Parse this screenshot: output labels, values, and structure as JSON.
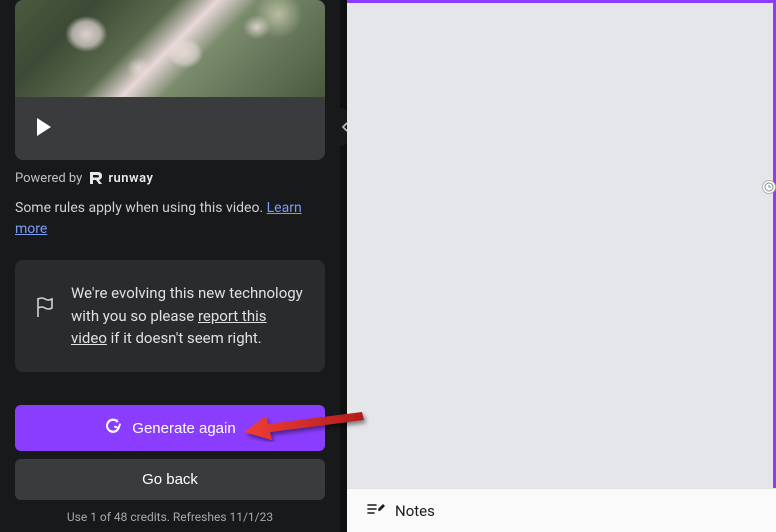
{
  "sidebar": {
    "powered_by": "Powered by",
    "runway_brand": "runway",
    "rules_text": "Some rules apply when using this video. ",
    "learn_more": "Learn more",
    "info": {
      "prefix": "We're evolving this new technology with you so please ",
      "report_link": "report this video",
      "suffix": " if it doesn't seem right."
    },
    "generate_button": "Generate again",
    "go_back_button": "Go back",
    "credits": "Use 1 of 48 credits. Refreshes 11/1/23"
  },
  "notes": {
    "label": "Notes"
  }
}
